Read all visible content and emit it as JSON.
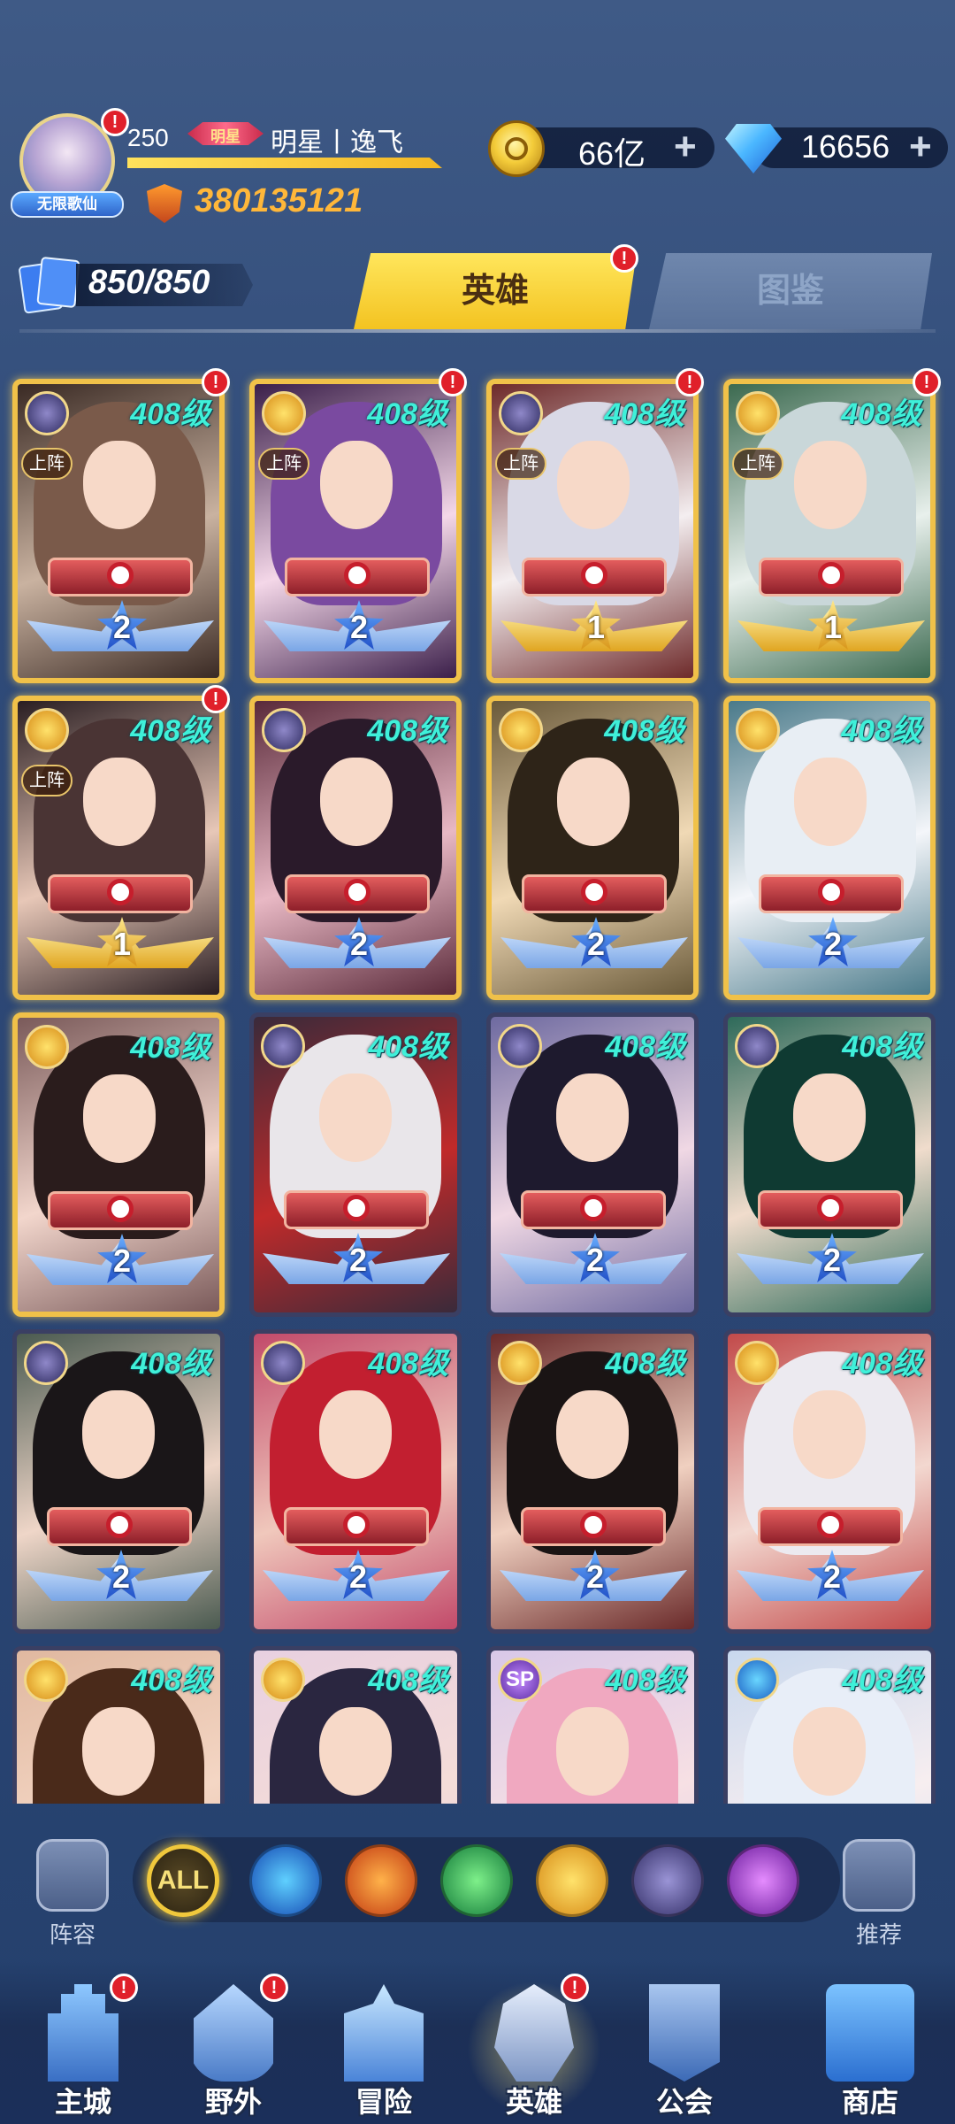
{
  "player": {
    "level": "250",
    "rank_badge": "明星",
    "name": "明星丨逸飞",
    "title_badge": "无限歌仙",
    "power": "380135121",
    "avatar_alert": "!"
  },
  "currency": {
    "gold": "66亿",
    "diamond": "16656",
    "plus": "+"
  },
  "hero_count": "850/850",
  "tabs": [
    {
      "label": "英雄",
      "active": true,
      "alert": "!"
    },
    {
      "label": "图鉴",
      "active": false
    }
  ],
  "heroes": [
    {
      "level": "408级",
      "faction": "dark",
      "stars": "2",
      "on_team": "上阵",
      "alert": "!",
      "frame": "gold",
      "palette": [
        "#3a2a24",
        "#7a5a4a",
        "#c9b2a0"
      ]
    },
    {
      "level": "408级",
      "faction": "light",
      "stars": "2",
      "on_team": "上阵",
      "alert": "!",
      "frame": "gold",
      "palette": [
        "#3b1f4a",
        "#7a4aa0",
        "#f4d7e8"
      ]
    },
    {
      "level": "408级",
      "faction": "dark",
      "stars": "1",
      "on_team": "上阵",
      "alert": "!",
      "frame": "gold",
      "palette": [
        "#6e2a2a",
        "#d9d9e6",
        "#f4eef0"
      ]
    },
    {
      "level": "408级",
      "faction": "light",
      "stars": "1",
      "on_team": "上阵",
      "alert": "!",
      "frame": "gold",
      "palette": [
        "#3c6a50",
        "#c9d7d9",
        "#e8f0ec"
      ]
    },
    {
      "level": "408级",
      "faction": "light",
      "stars": "1",
      "on_team": "上阵",
      "alert": "!",
      "frame": "gold",
      "palette": [
        "#2a1e22",
        "#4a3434",
        "#e7c7b7"
      ]
    },
    {
      "level": "408级",
      "faction": "dark",
      "stars": "2",
      "on_team": "",
      "alert": "",
      "frame": "gold",
      "palette": [
        "#5a2a3a",
        "#2a1a2a",
        "#e8b8c4"
      ]
    },
    {
      "level": "408级",
      "faction": "light",
      "stars": "2",
      "on_team": "",
      "alert": "",
      "frame": "gold",
      "palette": [
        "#6a5a3a",
        "#2e2418",
        "#f0d9b5"
      ]
    },
    {
      "level": "408级",
      "faction": "light",
      "stars": "2",
      "on_team": "",
      "alert": "",
      "frame": "gold",
      "palette": [
        "#4a7a8a",
        "#e8eef4",
        "#f4f6fa"
      ]
    },
    {
      "level": "408级",
      "faction": "light",
      "stars": "2",
      "on_team": "",
      "alert": "",
      "frame": "gold",
      "palette": [
        "#7a5a5a",
        "#2a1c1c",
        "#f2d6cc"
      ]
    },
    {
      "level": "408级",
      "faction": "dark",
      "stars": "2",
      "on_team": "",
      "alert": "",
      "frame": "purple",
      "palette": [
        "#3a2a3a",
        "#e9e6ea",
        "#c02a2a"
      ]
    },
    {
      "level": "408级",
      "faction": "dark",
      "stars": "2",
      "on_team": "",
      "alert": "",
      "frame": "purple",
      "palette": [
        "#6e6aa0",
        "#1e1a2e",
        "#f0d8e4"
      ]
    },
    {
      "level": "408级",
      "faction": "dark",
      "stars": "2",
      "on_team": "",
      "alert": "",
      "frame": "purple",
      "palette": [
        "#2e6a5a",
        "#0f3a32",
        "#f0dccc"
      ]
    },
    {
      "level": "408级",
      "faction": "dark",
      "stars": "2",
      "on_team": "",
      "alert": "",
      "frame": "purple",
      "palette": [
        "#4a5a50",
        "#1a1618",
        "#efd6c8"
      ]
    },
    {
      "level": "408级",
      "faction": "dark",
      "stars": "2",
      "on_team": "",
      "alert": "",
      "frame": "purple",
      "palette": [
        "#c24a6a",
        "#c21f30",
        "#f0c8bc"
      ]
    },
    {
      "level": "408级",
      "faction": "light",
      "stars": "2",
      "on_team": "",
      "alert": "",
      "frame": "purple",
      "palette": [
        "#6a2a2a",
        "#1a1414",
        "#f0d0c0"
      ]
    },
    {
      "level": "408级",
      "faction": "light",
      "stars": "2",
      "on_team": "",
      "alert": "",
      "frame": "purple",
      "palette": [
        "#c24a4a",
        "#eceaf0",
        "#f3d8d0"
      ]
    },
    {
      "level": "408级",
      "faction": "light",
      "stars": "",
      "on_team": "",
      "alert": "",
      "frame": "purple",
      "palette": [
        "#e0b8a0",
        "#4a2a1a",
        "#f4d6c4"
      ]
    },
    {
      "level": "408级",
      "faction": "light",
      "stars": "",
      "on_team": "",
      "alert": "",
      "frame": "purple",
      "palette": [
        "#e8d0e0",
        "#2a2640",
        "#f4dcd8"
      ]
    },
    {
      "level": "408级",
      "faction": "sp",
      "stars": "",
      "on_team": "",
      "alert": "",
      "frame": "purple",
      "palette": [
        "#d8c8e8",
        "#f0a8c0",
        "#f7e0e4"
      ]
    },
    {
      "level": "408级",
      "faction": "water",
      "stars": "",
      "on_team": "",
      "alert": "",
      "frame": "purple",
      "palette": [
        "#c8d8ee",
        "#e8eef8",
        "#f7eef0"
      ]
    }
  ],
  "filters": {
    "left_label": "阵容",
    "right_label": "推荐",
    "all_label": "ALL",
    "items": [
      "all",
      "water",
      "fire",
      "wind",
      "light",
      "dark",
      "void"
    ]
  },
  "nav": [
    {
      "label": "主城",
      "icon": "castle-icon",
      "alert": "!"
    },
    {
      "label": "野外",
      "icon": "portal-icon",
      "alert": "!"
    },
    {
      "label": "冒险",
      "icon": "sword-icon",
      "alert": ""
    },
    {
      "label": "英雄",
      "icon": "helmet-icon",
      "alert": "!",
      "active": true
    },
    {
      "label": "公会",
      "icon": "banner-icon",
      "alert": ""
    },
    {
      "label": "商店",
      "icon": "shop-icon",
      "alert": ""
    }
  ]
}
